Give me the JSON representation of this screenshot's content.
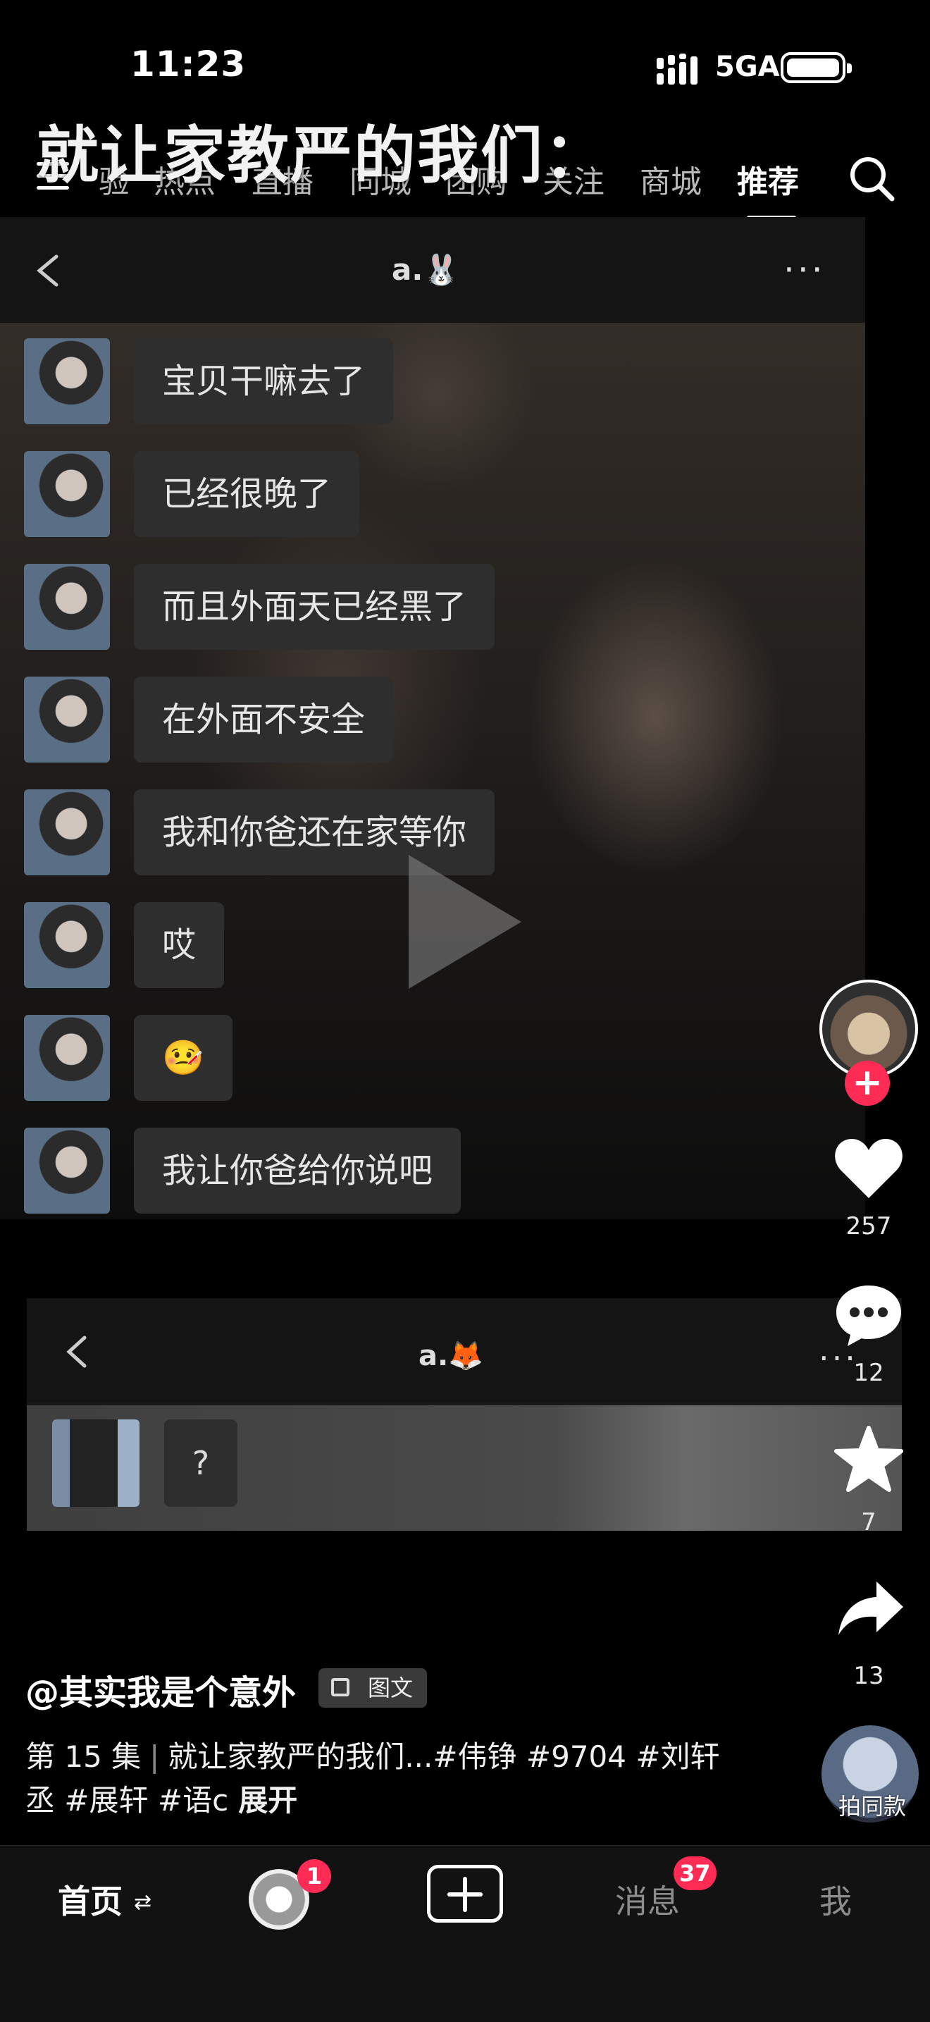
{
  "status_bar": {
    "time": "11:23",
    "network": "5GA"
  },
  "overlay_title": "就让家教严的我们：",
  "top_nav": {
    "tabs": [
      "验",
      "热点",
      "直播",
      "同城",
      "团购",
      "关注",
      "商城",
      "推荐"
    ],
    "active_tab": "推荐"
  },
  "chat1": {
    "contact": "a.🐰",
    "messages": [
      "宝贝干嘛去了",
      "已经很晚了",
      "而且外面天已经黑了",
      "在外面不安全",
      "我和你爸还在家等你",
      "哎",
      "🤒",
      "我让你爸给你说吧"
    ]
  },
  "chat2": {
    "contact": "a.🦊",
    "messages": [
      "?"
    ]
  },
  "actions": {
    "likes": "257",
    "comments": "12",
    "favorites": "7",
    "shares": "13"
  },
  "post": {
    "author": "@其实我是个意外",
    "type_badge": "图文",
    "episode": "第 15 集",
    "caption_line1": "就让家教严的我们...#伟铮 #9704 #刘轩",
    "caption_line2": "丞 #展轩 #语c",
    "expand": "展开",
    "same_style": "拍同款"
  },
  "tab_bar": {
    "home": "首页",
    "home_switch": "⇄",
    "friends_badge": "1",
    "messages": "消息",
    "messages_badge": "37",
    "me": "我"
  },
  "colors": {
    "accent": "#fe2c55",
    "background": "#000000"
  }
}
